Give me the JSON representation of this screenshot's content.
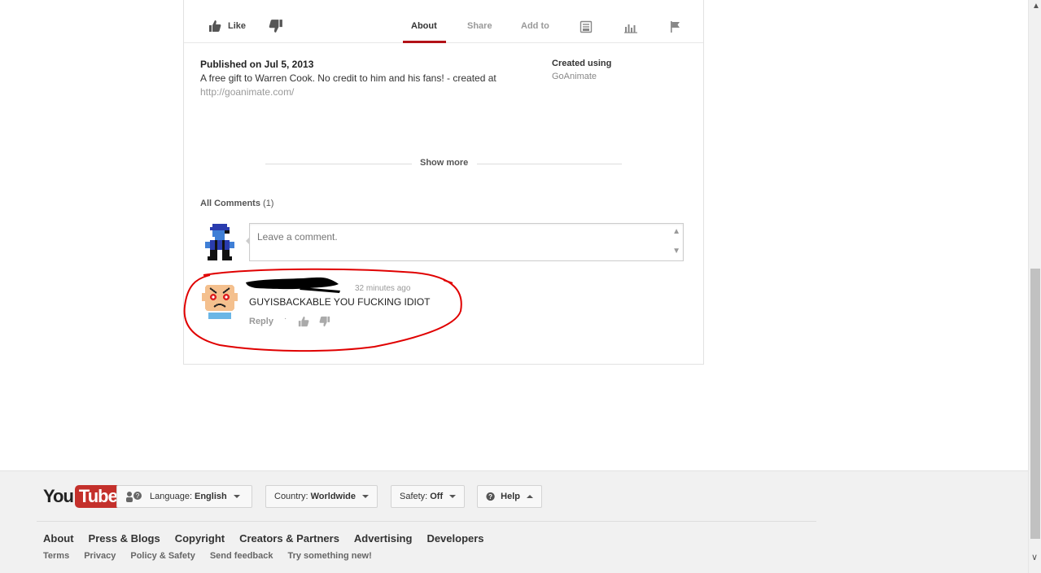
{
  "actions": {
    "like_label": "Like",
    "tabs": [
      {
        "label": "About",
        "active": true
      },
      {
        "label": "Share",
        "active": false
      },
      {
        "label": "Add to",
        "active": false
      }
    ],
    "tab_icons": [
      "transcript-icon",
      "statistics-icon",
      "flag-icon"
    ],
    "accent_color": "#b31217"
  },
  "description": {
    "published": "Published on Jul 5, 2013",
    "text": "A free gift to Warren Cook. No credit to him and his fans! - created at ",
    "link": "http://goanimate.com/",
    "created_using_label": "Created using",
    "created_using_value": "GoAnimate",
    "show_more": "Show more"
  },
  "comments": {
    "title": "All Comments",
    "count": "(1)",
    "input_placeholder": "Leave a comment.",
    "items": [
      {
        "time": "32 minutes ago",
        "text": "GUYISBACKABLE YOU FUCKING IDIOT",
        "reply_label": "Reply"
      }
    ],
    "highlight_color": "#e00000"
  },
  "footer": {
    "logo_you": "You",
    "logo_tube": "Tube",
    "language_label": "Language:",
    "language_value": "English",
    "country_label": "Country:",
    "country_value": "Worldwide",
    "safety_label": "Safety:",
    "safety_value": "Off",
    "help_label": "Help",
    "links": [
      "About",
      "Press & Blogs",
      "Copyright",
      "Creators & Partners",
      "Advertising",
      "Developers"
    ],
    "sublinks": [
      "Terms",
      "Privacy",
      "Policy & Safety",
      "Send feedback",
      "Try something new!"
    ]
  }
}
